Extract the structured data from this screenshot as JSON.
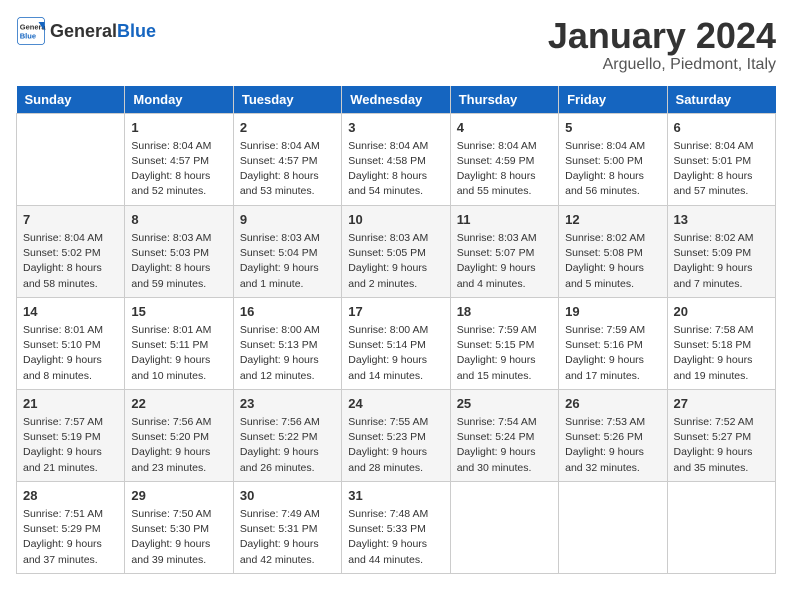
{
  "header": {
    "logo_general": "General",
    "logo_blue": "Blue",
    "month_title": "January 2024",
    "location": "Arguello, Piedmont, Italy"
  },
  "weekdays": [
    "Sunday",
    "Monday",
    "Tuesday",
    "Wednesday",
    "Thursday",
    "Friday",
    "Saturday"
  ],
  "weeks": [
    [
      {
        "num": "",
        "info": ""
      },
      {
        "num": "1",
        "info": "Sunrise: 8:04 AM\nSunset: 4:57 PM\nDaylight: 8 hours\nand 52 minutes."
      },
      {
        "num": "2",
        "info": "Sunrise: 8:04 AM\nSunset: 4:57 PM\nDaylight: 8 hours\nand 53 minutes."
      },
      {
        "num": "3",
        "info": "Sunrise: 8:04 AM\nSunset: 4:58 PM\nDaylight: 8 hours\nand 54 minutes."
      },
      {
        "num": "4",
        "info": "Sunrise: 8:04 AM\nSunset: 4:59 PM\nDaylight: 8 hours\nand 55 minutes."
      },
      {
        "num": "5",
        "info": "Sunrise: 8:04 AM\nSunset: 5:00 PM\nDaylight: 8 hours\nand 56 minutes."
      },
      {
        "num": "6",
        "info": "Sunrise: 8:04 AM\nSunset: 5:01 PM\nDaylight: 8 hours\nand 57 minutes."
      }
    ],
    [
      {
        "num": "7",
        "info": "Sunrise: 8:04 AM\nSunset: 5:02 PM\nDaylight: 8 hours\nand 58 minutes."
      },
      {
        "num": "8",
        "info": "Sunrise: 8:03 AM\nSunset: 5:03 PM\nDaylight: 8 hours\nand 59 minutes."
      },
      {
        "num": "9",
        "info": "Sunrise: 8:03 AM\nSunset: 5:04 PM\nDaylight: 9 hours\nand 1 minute."
      },
      {
        "num": "10",
        "info": "Sunrise: 8:03 AM\nSunset: 5:05 PM\nDaylight: 9 hours\nand 2 minutes."
      },
      {
        "num": "11",
        "info": "Sunrise: 8:03 AM\nSunset: 5:07 PM\nDaylight: 9 hours\nand 4 minutes."
      },
      {
        "num": "12",
        "info": "Sunrise: 8:02 AM\nSunset: 5:08 PM\nDaylight: 9 hours\nand 5 minutes."
      },
      {
        "num": "13",
        "info": "Sunrise: 8:02 AM\nSunset: 5:09 PM\nDaylight: 9 hours\nand 7 minutes."
      }
    ],
    [
      {
        "num": "14",
        "info": "Sunrise: 8:01 AM\nSunset: 5:10 PM\nDaylight: 9 hours\nand 8 minutes."
      },
      {
        "num": "15",
        "info": "Sunrise: 8:01 AM\nSunset: 5:11 PM\nDaylight: 9 hours\nand 10 minutes."
      },
      {
        "num": "16",
        "info": "Sunrise: 8:00 AM\nSunset: 5:13 PM\nDaylight: 9 hours\nand 12 minutes."
      },
      {
        "num": "17",
        "info": "Sunrise: 8:00 AM\nSunset: 5:14 PM\nDaylight: 9 hours\nand 14 minutes."
      },
      {
        "num": "18",
        "info": "Sunrise: 7:59 AM\nSunset: 5:15 PM\nDaylight: 9 hours\nand 15 minutes."
      },
      {
        "num": "19",
        "info": "Sunrise: 7:59 AM\nSunset: 5:16 PM\nDaylight: 9 hours\nand 17 minutes."
      },
      {
        "num": "20",
        "info": "Sunrise: 7:58 AM\nSunset: 5:18 PM\nDaylight: 9 hours\nand 19 minutes."
      }
    ],
    [
      {
        "num": "21",
        "info": "Sunrise: 7:57 AM\nSunset: 5:19 PM\nDaylight: 9 hours\nand 21 minutes."
      },
      {
        "num": "22",
        "info": "Sunrise: 7:56 AM\nSunset: 5:20 PM\nDaylight: 9 hours\nand 23 minutes."
      },
      {
        "num": "23",
        "info": "Sunrise: 7:56 AM\nSunset: 5:22 PM\nDaylight: 9 hours\nand 26 minutes."
      },
      {
        "num": "24",
        "info": "Sunrise: 7:55 AM\nSunset: 5:23 PM\nDaylight: 9 hours\nand 28 minutes."
      },
      {
        "num": "25",
        "info": "Sunrise: 7:54 AM\nSunset: 5:24 PM\nDaylight: 9 hours\nand 30 minutes."
      },
      {
        "num": "26",
        "info": "Sunrise: 7:53 AM\nSunset: 5:26 PM\nDaylight: 9 hours\nand 32 minutes."
      },
      {
        "num": "27",
        "info": "Sunrise: 7:52 AM\nSunset: 5:27 PM\nDaylight: 9 hours\nand 35 minutes."
      }
    ],
    [
      {
        "num": "28",
        "info": "Sunrise: 7:51 AM\nSunset: 5:29 PM\nDaylight: 9 hours\nand 37 minutes."
      },
      {
        "num": "29",
        "info": "Sunrise: 7:50 AM\nSunset: 5:30 PM\nDaylight: 9 hours\nand 39 minutes."
      },
      {
        "num": "30",
        "info": "Sunrise: 7:49 AM\nSunset: 5:31 PM\nDaylight: 9 hours\nand 42 minutes."
      },
      {
        "num": "31",
        "info": "Sunrise: 7:48 AM\nSunset: 5:33 PM\nDaylight: 9 hours\nand 44 minutes."
      },
      {
        "num": "",
        "info": ""
      },
      {
        "num": "",
        "info": ""
      },
      {
        "num": "",
        "info": ""
      }
    ]
  ]
}
